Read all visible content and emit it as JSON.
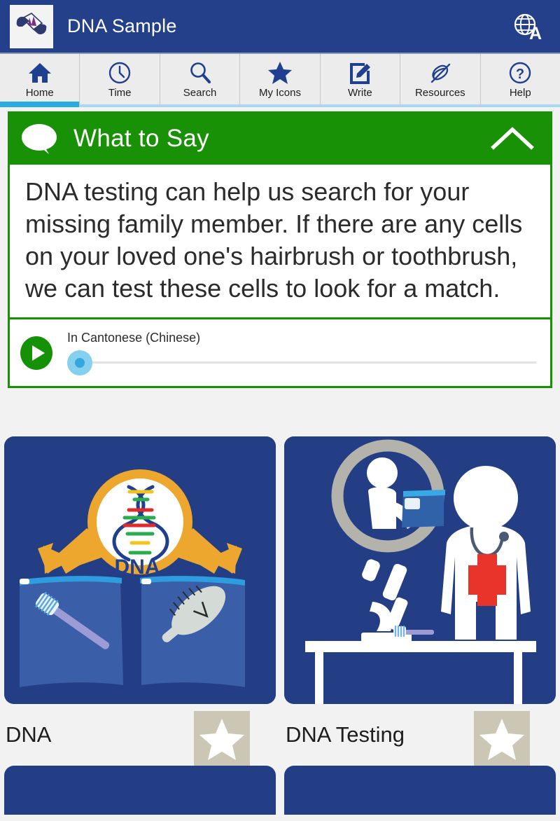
{
  "titlebar": {
    "app_icon_name": "hands-holding-document-icon",
    "title": "DNA Sample",
    "language_button_label": "globe-a-icon",
    "background_color": "#24408a"
  },
  "tabs": [
    {
      "label": "Home",
      "icon": "home-icon",
      "active": true
    },
    {
      "label": "Time",
      "icon": "clock-icon",
      "active": false
    },
    {
      "label": "Search",
      "icon": "magnifier-icon",
      "active": false
    },
    {
      "label": "My Icons",
      "icon": "star-icon",
      "active": false
    },
    {
      "label": "Write",
      "icon": "pencil-square-icon",
      "active": false
    },
    {
      "label": "Resources",
      "icon": "paperclip-icon",
      "active": false
    },
    {
      "label": "Help",
      "icon": "question-circle-icon",
      "active": false
    }
  ],
  "what_to_say": {
    "header_title": "What to Say",
    "header_icon": "speech-bubble-icon",
    "collapse_icon": "chevron-up-icon",
    "accent_color": "#189106",
    "body_text": "DNA testing can help us search for your missing family member. If there are any cells on your loved one's hairbrush or toothbrush, we can test these cells to look for a match.",
    "audio": {
      "play_icon": "play-circle-icon",
      "language_label": "In Cantonese (Chinese)",
      "progress_percent": 0
    }
  },
  "cards": [
    {
      "label": "DNA",
      "image_name": "dna-magnifier-toothbrush-hairbrush-illustration",
      "favorite_icon": "star-icon"
    },
    {
      "label": "DNA Testing",
      "image_name": "doctor-microscope-toothbrush-illustration",
      "favorite_icon": "star-icon"
    }
  ],
  "card_colors": {
    "image_background": "#243e85",
    "favorite_button": "#cbc7b4",
    "dna_ring": "#eea72e",
    "red_cross": "#e8342a"
  },
  "next_row_cards": [
    {
      "image_name": "card-placeholder-3"
    },
    {
      "image_name": "card-placeholder-4"
    }
  ]
}
